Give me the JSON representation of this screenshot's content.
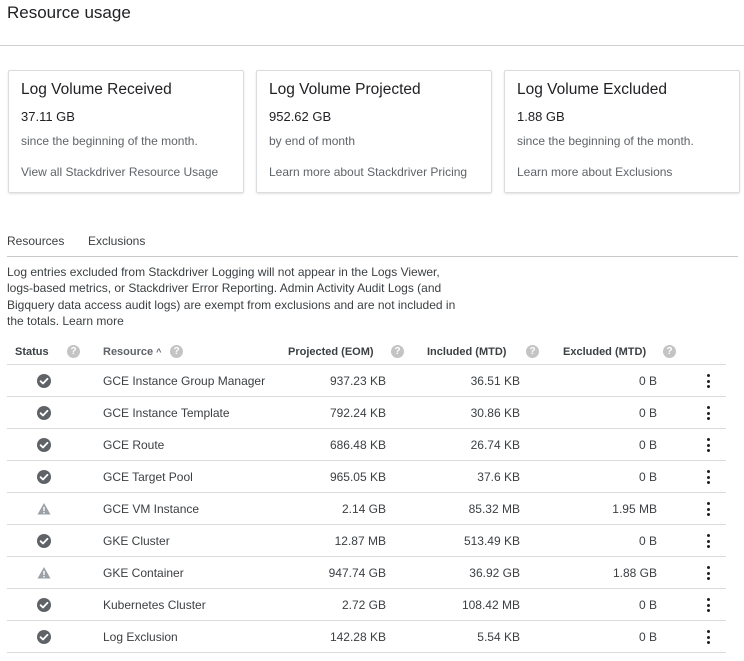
{
  "page": {
    "title": "Resource usage"
  },
  "cards": [
    {
      "title": "Log Volume Received",
      "value": "37.11 GB",
      "subtitle": "since the beginning of the month.",
      "link": "View all Stackdriver Resource Usage"
    },
    {
      "title": "Log Volume Projected",
      "value": "952.62 GB",
      "subtitle": "by end of month",
      "link": "Learn more about Stackdriver Pricing"
    },
    {
      "title": "Log Volume Excluded",
      "value": "1.88 GB",
      "subtitle": "since the beginning of the month.",
      "link": "Learn more about Exclusions"
    }
  ],
  "tabs": [
    {
      "label": "Resources",
      "active": true
    },
    {
      "label": "Exclusions",
      "active": false
    }
  ],
  "info": {
    "text": "Log entries excluded from Stackdriver Logging will not appear in the Logs Viewer, logs-based metrics, or Stackdriver Error Reporting. Admin Activity Audit Logs (and Bigquery data access audit logs) are exempt from exclusions and are not included in the totals.",
    "learn_more": "Learn more"
  },
  "table": {
    "headers": {
      "status": "Status",
      "resource": "Resource",
      "projected": "Projected (EOM)",
      "included": "Included (MTD)",
      "excluded": "Excluded (MTD)"
    },
    "sort_indicator": "^",
    "help_glyph": "?",
    "rows": [
      {
        "status": "ok",
        "resource": "GCE Instance Group Manager",
        "projected": "937.23 KB",
        "included": "36.51 KB",
        "excluded": "0 B"
      },
      {
        "status": "ok",
        "resource": "GCE Instance Template",
        "projected": "792.24 KB",
        "included": "30.86 KB",
        "excluded": "0 B"
      },
      {
        "status": "ok",
        "resource": "GCE Route",
        "projected": "686.48 KB",
        "included": "26.74 KB",
        "excluded": "0 B"
      },
      {
        "status": "ok",
        "resource": "GCE Target Pool",
        "projected": "965.05 KB",
        "included": "37.6 KB",
        "excluded": "0 B"
      },
      {
        "status": "warning",
        "resource": "GCE VM Instance",
        "projected": "2.14 GB",
        "included": "85.32 MB",
        "excluded": "1.95 MB"
      },
      {
        "status": "ok",
        "resource": "GKE Cluster",
        "projected": "12.87 MB",
        "included": "513.49 KB",
        "excluded": "0 B"
      },
      {
        "status": "warning",
        "resource": "GKE Container",
        "projected": "947.74 GB",
        "included": "36.92 GB",
        "excluded": "1.88 GB"
      },
      {
        "status": "ok",
        "resource": "Kubernetes Cluster",
        "projected": "2.72 GB",
        "included": "108.42 MB",
        "excluded": "0 B"
      },
      {
        "status": "ok",
        "resource": "Log Exclusion",
        "projected": "142.28 KB",
        "included": "5.54 KB",
        "excluded": "0 B"
      }
    ]
  },
  "colors": {
    "ok_icon": "#5f6368",
    "warning_icon": "#9aa0a6",
    "accent": "#1a73e8"
  },
  "icons": {
    "ok": "check-circle-icon",
    "warning": "warning-triangle-icon",
    "help": "help-circle-icon",
    "menu": "more-vert-icon"
  }
}
